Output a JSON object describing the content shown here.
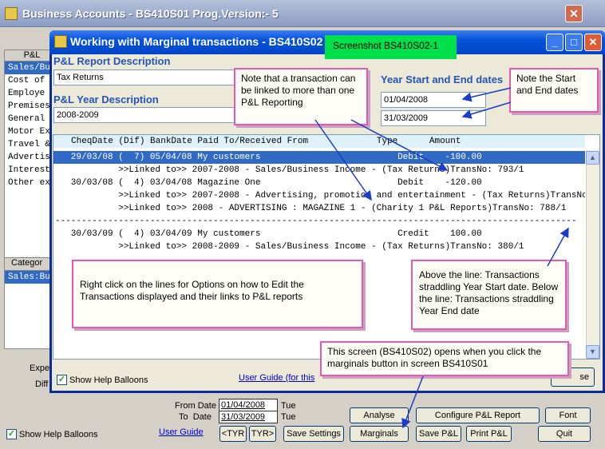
{
  "parent_window": {
    "title": "Business Accounts   - BS410S01   Prog.Version:-  5",
    "sidebar_header": "P&L",
    "sidebar_items": [
      "Sales/Bu",
      "Cost of",
      "Employe",
      "Premises",
      "General",
      "Motor Ex",
      "Travel &",
      "Advertis",
      "Interest",
      "Other ex"
    ],
    "category_header": "Categor",
    "category_selected": "Sales:Bu",
    "expe_label": "Expe",
    "diff_label": "Diff",
    "from_date_label": "From Date",
    "from_date_value": "01/04/2008",
    "from_day": "Tue",
    "to_date_label": "To  Date",
    "to_date_value": "31/03/2009",
    "to_day": "Tue",
    "show_help_balloons_label": "Show Help Balloons",
    "user_guide_link": "User Guide",
    "buttons": {
      "prev_tyr": "<TYR",
      "next_tyr": "TYR>",
      "save_settings": "Save Settings",
      "marginals": "Marginals",
      "save_pl": "Save P&L",
      "print_pl": "Print P&L",
      "analyse": "Analyse",
      "configure": "Configure P&L Report",
      "font": "Font",
      "quit": "Quit"
    }
  },
  "child_window": {
    "title": "Working with Marginal transactions  - BS410S02",
    "pl_report_label": "P&L Report Description",
    "pl_report_value": "Tax Returns",
    "pl_year_label": "P&L Year Description",
    "pl_year_value": "2008-2009",
    "year_dates_label": "Year Start and End dates",
    "year_start": "01/04/2008",
    "year_end": "31/03/2009",
    "list_header": "CheqDate (Dif) BankDate Paid To/Received From             Type      Amount",
    "rows": [
      "   29/03/08 (  7) 05/04/08 My customers                          Debit    -100.00",
      "            >>Linked to>> 2007-2008 - Sales/Business Income - (Tax Returns)TransNo: 793/1",
      "   30/03/08 (  4) 03/04/08 Magazine One                          Debit    -120.00",
      "            >>Linked to>> 2007-2008 - Advertising, promotion and entertainment - (Tax Returns)TransNo",
      "            >>Linked to>> 2008 - ADVERTISING : MAGAZINE 1 - (Charity 1 P&L Reports)TransNo: 788/1",
      "---------------------------------------------------------------------------------------------------",
      "   30/03/09 (  4) 03/04/09 My customers                          Credit    100.00",
      "            >>Linked to>> 2008-2009 - Sales/Business Income - (Tax Returns)TransNo: 380/1"
    ],
    "show_help_balloons_label": "Show Help Balloons",
    "user_guide_link": "User Guide (for this",
    "close_partial": "se"
  },
  "callouts": {
    "screenshot_tag": "Screenshot BS410S02-1",
    "note_linked": "Note that a transaction can be linked to more than one P&L Reporting",
    "note_dates": "Note the Start and End dates",
    "note_right_click": "Right click on the lines for Options on how to Edit the Transactions displayed and their links to P&L reports",
    "note_line": "Above the line: Transactions straddling Year Start date. Below the line: Transactions straddling Year End date",
    "note_marginals": "This screen (BS410S02) opens when you click the marginals button in screen BS410S01"
  }
}
